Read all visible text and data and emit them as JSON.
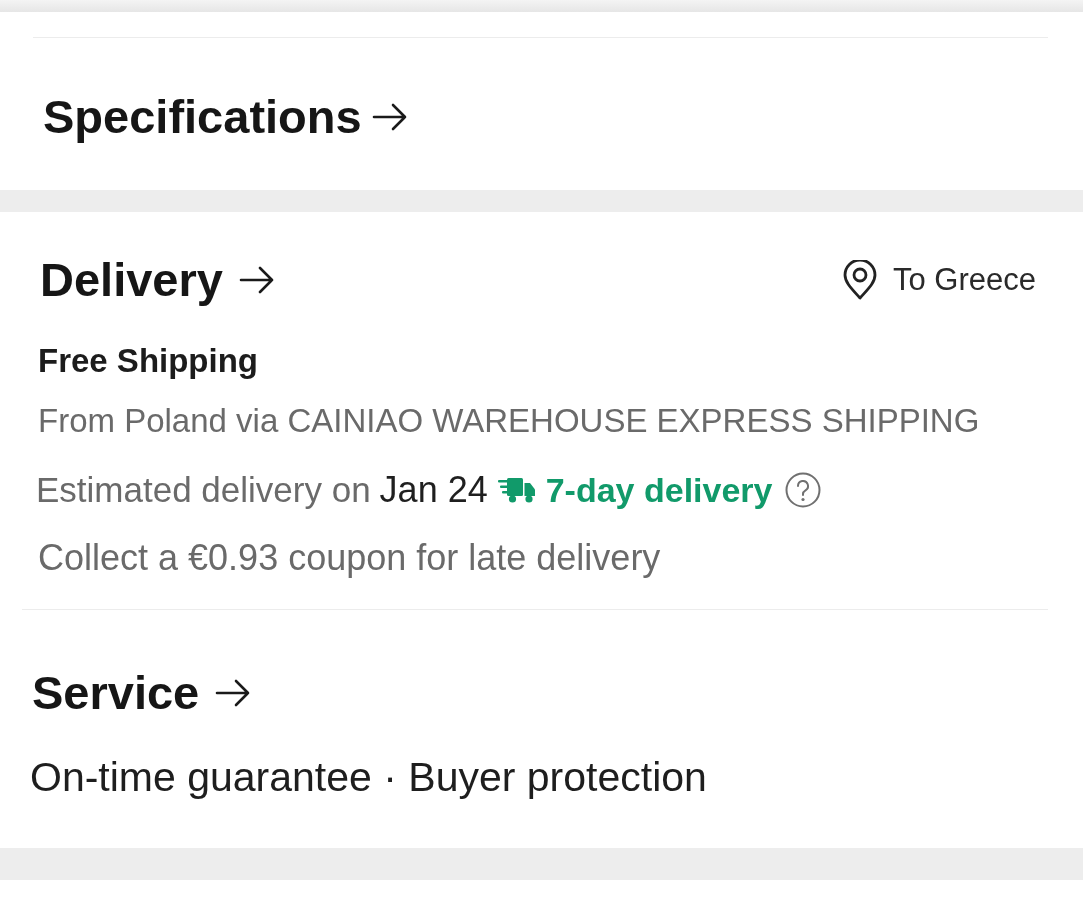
{
  "specifications": {
    "title": "Specifications"
  },
  "delivery": {
    "title": "Delivery",
    "destination": "To Greece",
    "shipping": "Free Shipping",
    "route": "From Poland via CAINIAO WAREHOUSE EXPRESS SHIPPING",
    "estimate": {
      "label": "Estimated delivery on",
      "date": "Jan 24",
      "badge": "7-day delivery"
    },
    "coupon": "Collect a €0.93 coupon for late delivery"
  },
  "service": {
    "title": "Service",
    "features": "On-time guarantee · Buyer protection"
  }
}
